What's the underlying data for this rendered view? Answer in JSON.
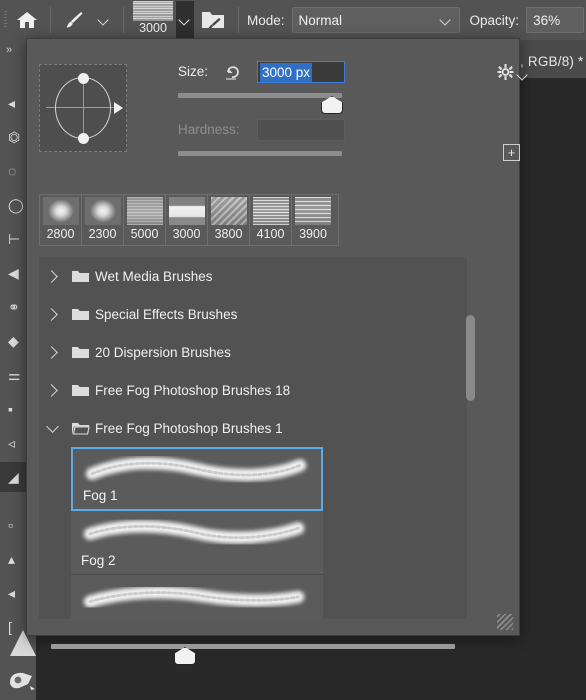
{
  "app": {
    "document_title": ", RGB/8) *"
  },
  "options_bar": {
    "home_icon": "home-icon",
    "tool_icon": "brush-tool-icon",
    "tool_chevron": "chevron-down-icon",
    "brush_preview_size": "3000",
    "brush_preview_chevron": "chevron-down-icon",
    "brush_panel_icon": "brush-folder-icon",
    "mode_label": "Mode:",
    "mode_value": "Normal",
    "mode_chevron": "chevron-down-icon",
    "opacity_label": "Opacity:",
    "opacity_value": "36%"
  },
  "toolstrip": {
    "collapse_icon": "expand-arrows-icon",
    "tools": [
      "move-tool-icon",
      "marquee-tool-icon",
      "lasso-tool-icon",
      "object-select-tool-icon",
      "crop-tool-icon",
      "frame-tool-icon",
      "eyedropper-tool-icon",
      "healing-brush-tool-icon",
      "brush-tool-icon",
      "clone-stamp-tool-icon",
      "eraser-tool-icon",
      "gradient-tool-icon",
      "blur-tool-icon",
      "dodge-tool-icon",
      "pen-tool-icon",
      "type-tool-icon"
    ],
    "bottom_tools": [
      "gradient-tool-icon",
      "hand-tool-icon"
    ]
  },
  "picker": {
    "tip_preview_icon": "brush-tip-angle-roundness-preview",
    "size": {
      "label": "Size:",
      "reset_icon": "reset-arrow-icon",
      "value": "3000 px",
      "selected": true,
      "slider_percent": 93
    },
    "hardness": {
      "label": "Hardness:",
      "value": "",
      "disabled": true,
      "slider_percent": 0
    },
    "gear_icon": "gear-icon",
    "gear_chevron": "chevron-down-icon",
    "new_brush_icon": "plus-square-icon",
    "presets": [
      {
        "label": "2800",
        "style": "soft"
      },
      {
        "label": "2300",
        "style": "soft"
      },
      {
        "label": "5000",
        "style": "tex1"
      },
      {
        "label": "3000",
        "style": "tex2"
      },
      {
        "label": "3800",
        "style": "tex3"
      },
      {
        "label": "4100",
        "style": "tex4"
      },
      {
        "label": "3900",
        "style": "tex5"
      }
    ],
    "folders": [
      {
        "label": "Wet Media Brushes",
        "expanded": false
      },
      {
        "label": "Special Effects Brushes",
        "expanded": false
      },
      {
        "label": "20 Dispersion Brushes",
        "expanded": false
      },
      {
        "label": "Free Fog Photoshop Brushes 18",
        "expanded": false
      },
      {
        "label": "Free Fog Photoshop Brushes 1",
        "expanded": true
      }
    ],
    "brushes": [
      {
        "label": "Fog 1",
        "selected": true
      },
      {
        "label": "Fog 2",
        "selected": false
      },
      {
        "label": "",
        "selected": false
      }
    ],
    "vertical_scrollbar": "list-scrollbar",
    "bottom_slider": "preview-size-slider",
    "bottom_slider_percent": 34,
    "resize_grip": "resize-grip-icon"
  },
  "colors": {
    "panel_bg": "#595959",
    "options_bar_bg": "#535353",
    "list_bg": "#525252",
    "selection_blue": "#5aabe8",
    "text_highlight_blue": "#2f6fc4",
    "canvas_bg": "#292929"
  }
}
